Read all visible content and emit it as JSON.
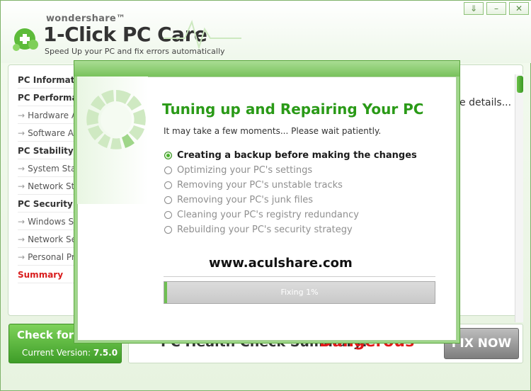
{
  "window": {
    "brand_small": "wondershare™",
    "app_title": "1-Click PC Care",
    "tagline": "Speed Up your PC and fix errors automatically",
    "controls": [
      "⇓",
      "–",
      "✕"
    ]
  },
  "sidebar": {
    "items": [
      {
        "label": "PC Informati",
        "kind": "category"
      },
      {
        "label": "PC Performan",
        "kind": "category"
      },
      {
        "label": "Hardware A",
        "kind": "sub"
      },
      {
        "label": "Software A",
        "kind": "sub"
      },
      {
        "label": "PC Stability",
        "kind": "category"
      },
      {
        "label": "System Sta",
        "kind": "sub"
      },
      {
        "label": "Network St",
        "kind": "sub"
      },
      {
        "label": "PC Security",
        "kind": "category"
      },
      {
        "label": "Windows S",
        "kind": "sub"
      },
      {
        "label": "Network Se",
        "kind": "sub"
      },
      {
        "label": "Personal Pri",
        "kind": "sub"
      },
      {
        "label": "Summary",
        "kind": "active"
      }
    ]
  },
  "content": {
    "details_text": "e details..."
  },
  "bottom": {
    "check_label": "Check for",
    "version_label": "Current Version:",
    "version_value": "7.5.0",
    "summary_label": "PC Health Check Summary:",
    "summary_status": "Dangerous",
    "fix_now": "FIX NOW"
  },
  "dialog": {
    "title": "Tuning up and Repairing Your PC",
    "subtitle": "It may take a few moments... Please wait patiently.",
    "steps": [
      {
        "label": "Creating a backup before making the changes",
        "state": "active"
      },
      {
        "label": "Optimizing your PC's settings",
        "state": "pending"
      },
      {
        "label": "Removing your PC's unstable tracks",
        "state": "pending"
      },
      {
        "label": "Removing your PC's junk files",
        "state": "pending"
      },
      {
        "label": "Cleaning your PC's registry redundancy",
        "state": "pending"
      },
      {
        "label": "Rebuilding your PC's security strategy",
        "state": "pending"
      }
    ],
    "watermark": "www.aculshare.com",
    "progress_label": "Fixing 1%",
    "progress_value": 0.01
  },
  "colors": {
    "accent_green": "#2a9a17",
    "danger_red": "#e11a1a"
  }
}
